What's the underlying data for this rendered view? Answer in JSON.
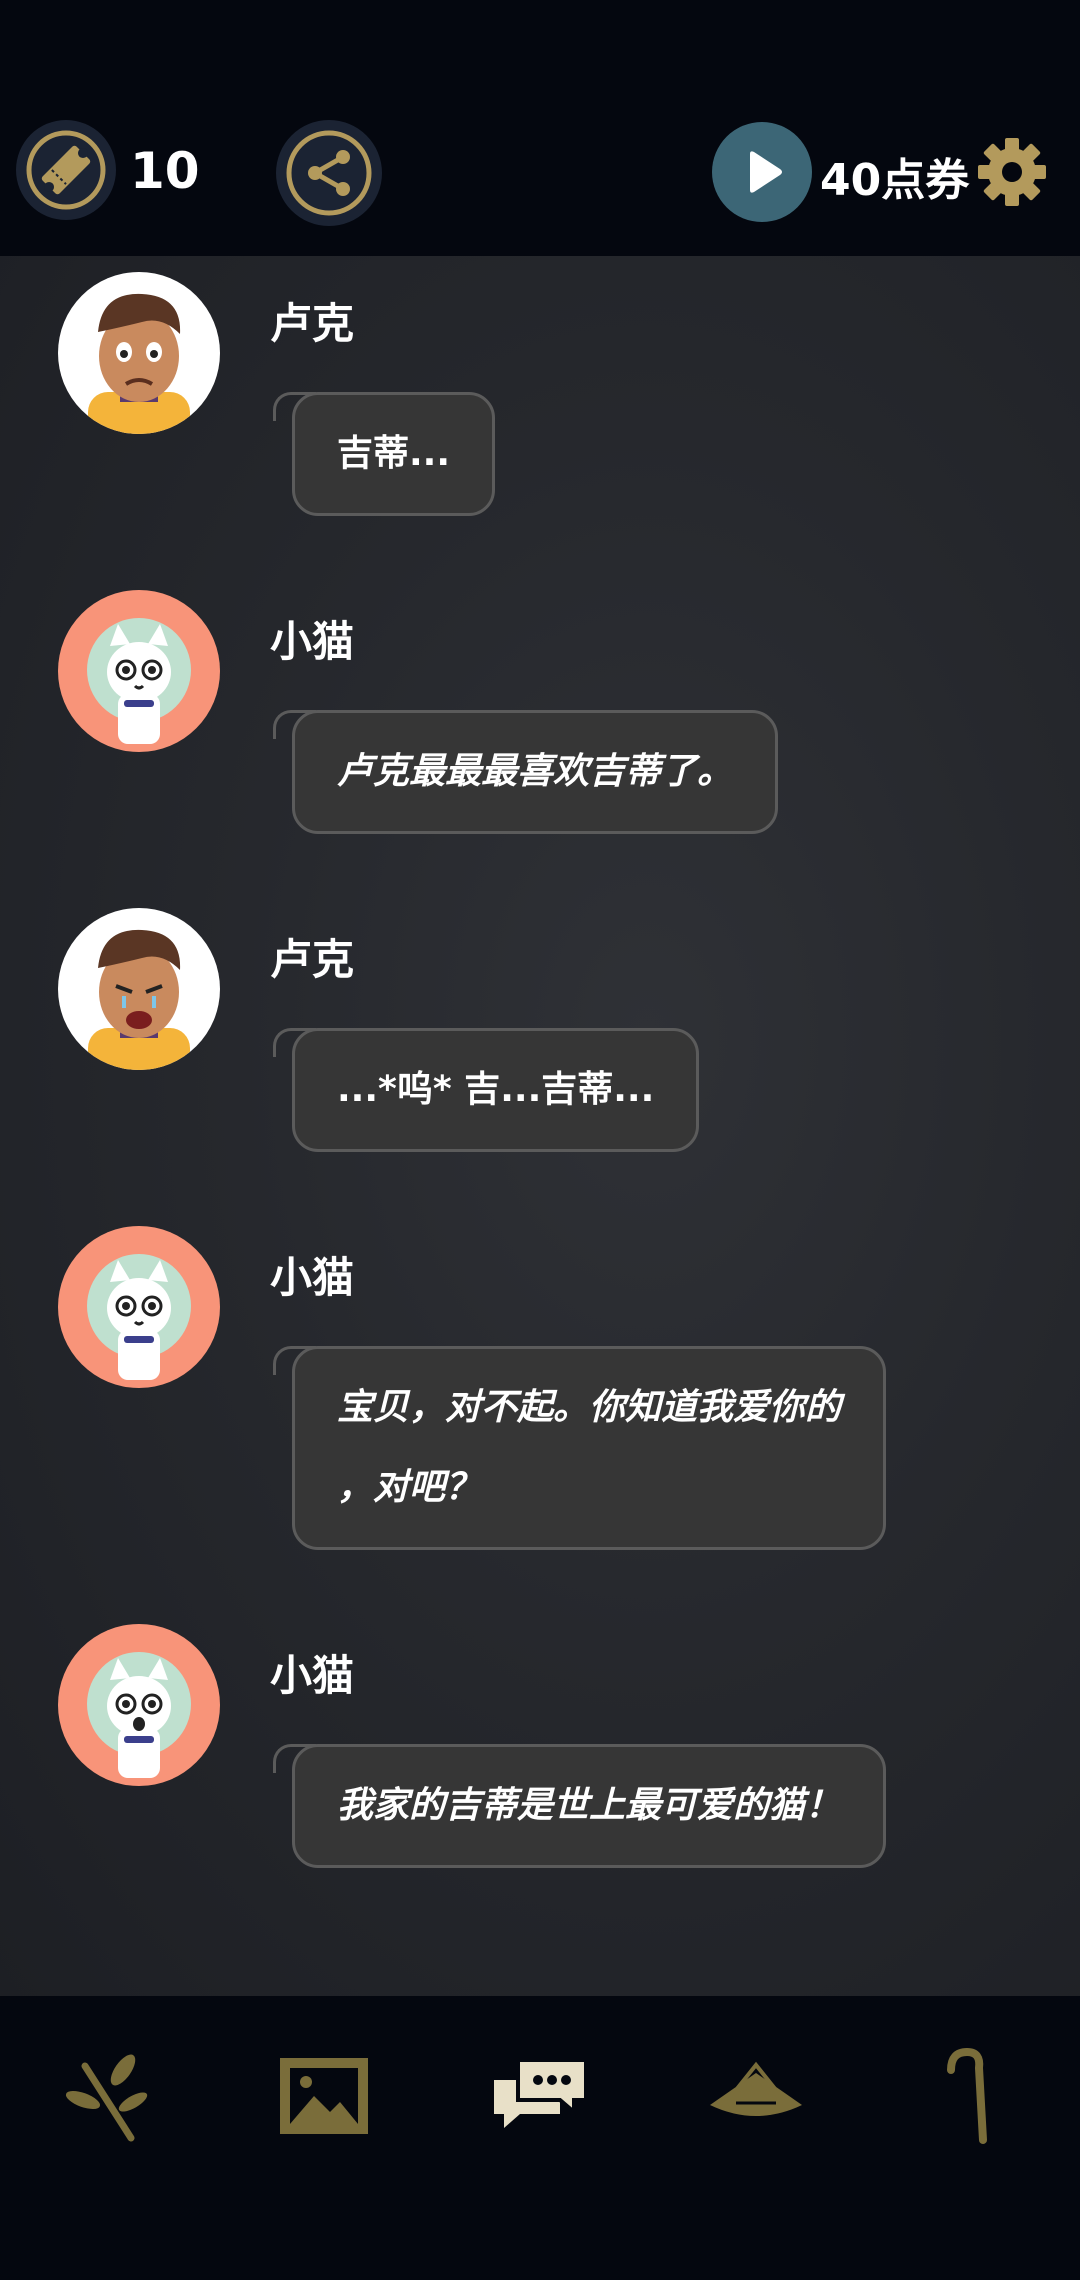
{
  "header": {
    "ticket_count": "10",
    "coupon_label": "40点券",
    "accent_gold": "#b39a5c",
    "icons": [
      "ticket-icon",
      "share-icon",
      "play-icon",
      "gear-icon"
    ]
  },
  "messages": [
    {
      "speaker": "卢克",
      "text": "吉蒂...",
      "italic": false,
      "avatar": "luke"
    },
    {
      "speaker": "小猫",
      "text": "卢克最最最喜欢吉蒂了。",
      "italic": true,
      "avatar": "cat"
    },
    {
      "speaker": "卢克",
      "text": "...*呜* 吉...吉蒂...",
      "italic": false,
      "avatar": "luke"
    },
    {
      "speaker": "小猫",
      "text_line1": "宝贝，对不起。你知道我爱你的",
      "text_line2": "，对吧？",
      "italic": true,
      "avatar": "cat"
    },
    {
      "speaker": "小猫",
      "text": "我家的吉蒂是世上最可爱的猫！",
      "italic": true,
      "avatar": "cat"
    }
  ],
  "bottom_nav": {
    "icons": [
      "branch-icon",
      "gallery-icon",
      "chat-icon",
      "hat-icon",
      "cane-icon"
    ],
    "active": "chat-icon"
  }
}
